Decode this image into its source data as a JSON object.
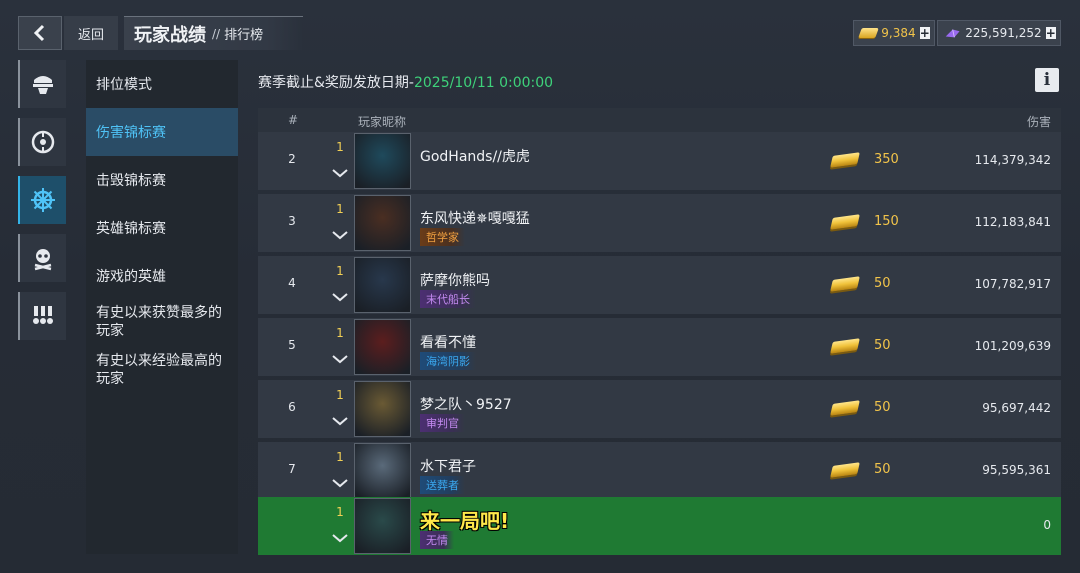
{
  "header": {
    "back_label": "返回",
    "title": "玩家战绩",
    "separator": "//",
    "subtitle": "排行榜"
  },
  "currency": {
    "gold": "9,384",
    "gems": "225,591,252",
    "gold_icon": "gold-bar-icon",
    "gem_icon": "purple-gem-icon"
  },
  "side_icons": [
    {
      "name": "helmet-icon",
      "active": false
    },
    {
      "name": "target-icon",
      "active": false
    },
    {
      "name": "ship-wheel-icon",
      "active": true
    },
    {
      "name": "skull-crossbones-icon",
      "active": false
    },
    {
      "name": "medals-icon",
      "active": false
    }
  ],
  "menu": [
    {
      "label": "排位模式",
      "active": false
    },
    {
      "label": "伤害锦标赛",
      "active": true
    },
    {
      "label": "击毁锦标赛",
      "active": false
    },
    {
      "label": "英雄锦标赛",
      "active": false
    },
    {
      "label": "游戏的英雄",
      "active": false
    },
    {
      "label": "有史以来获赞最多的玩家",
      "active": false
    },
    {
      "label": "有史以来经验最高的玩家",
      "active": false
    }
  ],
  "season": {
    "label": "赛季截止&奖励发放日期-",
    "date": "2025/10/11 0:00:00"
  },
  "table": {
    "col_rank": "#",
    "col_name": "玩家昵称",
    "col_damage": "伤害",
    "rows": [
      {
        "rank": "2",
        "tier": "1",
        "name": "GodHands//虎虎",
        "badge": "",
        "badge_color": "",
        "reward": "350",
        "damage": "114,379,342",
        "avatar": "#1f4a5c"
      },
      {
        "rank": "3",
        "tier": "1",
        "name": "东风快递✵嘎嘎猛",
        "badge": "哲学家",
        "badge_color": "orange",
        "reward": "150",
        "damage": "112,183,841",
        "avatar": "#4a2e22"
      },
      {
        "rank": "4",
        "tier": "1",
        "name": "萨摩你熊吗",
        "badge": "末代船长",
        "badge_color": "purple",
        "reward": "50",
        "damage": "107,782,917",
        "avatar": "#28384c"
      },
      {
        "rank": "5",
        "tier": "1",
        "name": "看看不懂",
        "badge": "海湾阴影",
        "badge_color": "blue",
        "reward": "50",
        "damage": "101,209,639",
        "avatar": "#5c1e1e"
      },
      {
        "rank": "6",
        "tier": "1",
        "name": "梦之队丶9527",
        "badge": "审判官",
        "badge_color": "purple",
        "reward": "50",
        "damage": "95,697,442",
        "avatar": "#6a5a34"
      },
      {
        "rank": "7",
        "tier": "1",
        "name": "水下君子",
        "badge": "送葬者",
        "badge_color": "blue",
        "reward": "50",
        "damage": "95,595,361",
        "avatar": "#5a6a7a"
      },
      {
        "rank": "",
        "tier": "1",
        "name": "来一局吧!",
        "badge": "无情",
        "badge_color": "purple",
        "reward": "",
        "damage": "0",
        "avatar": "#2a4a4a",
        "me": true
      }
    ]
  }
}
